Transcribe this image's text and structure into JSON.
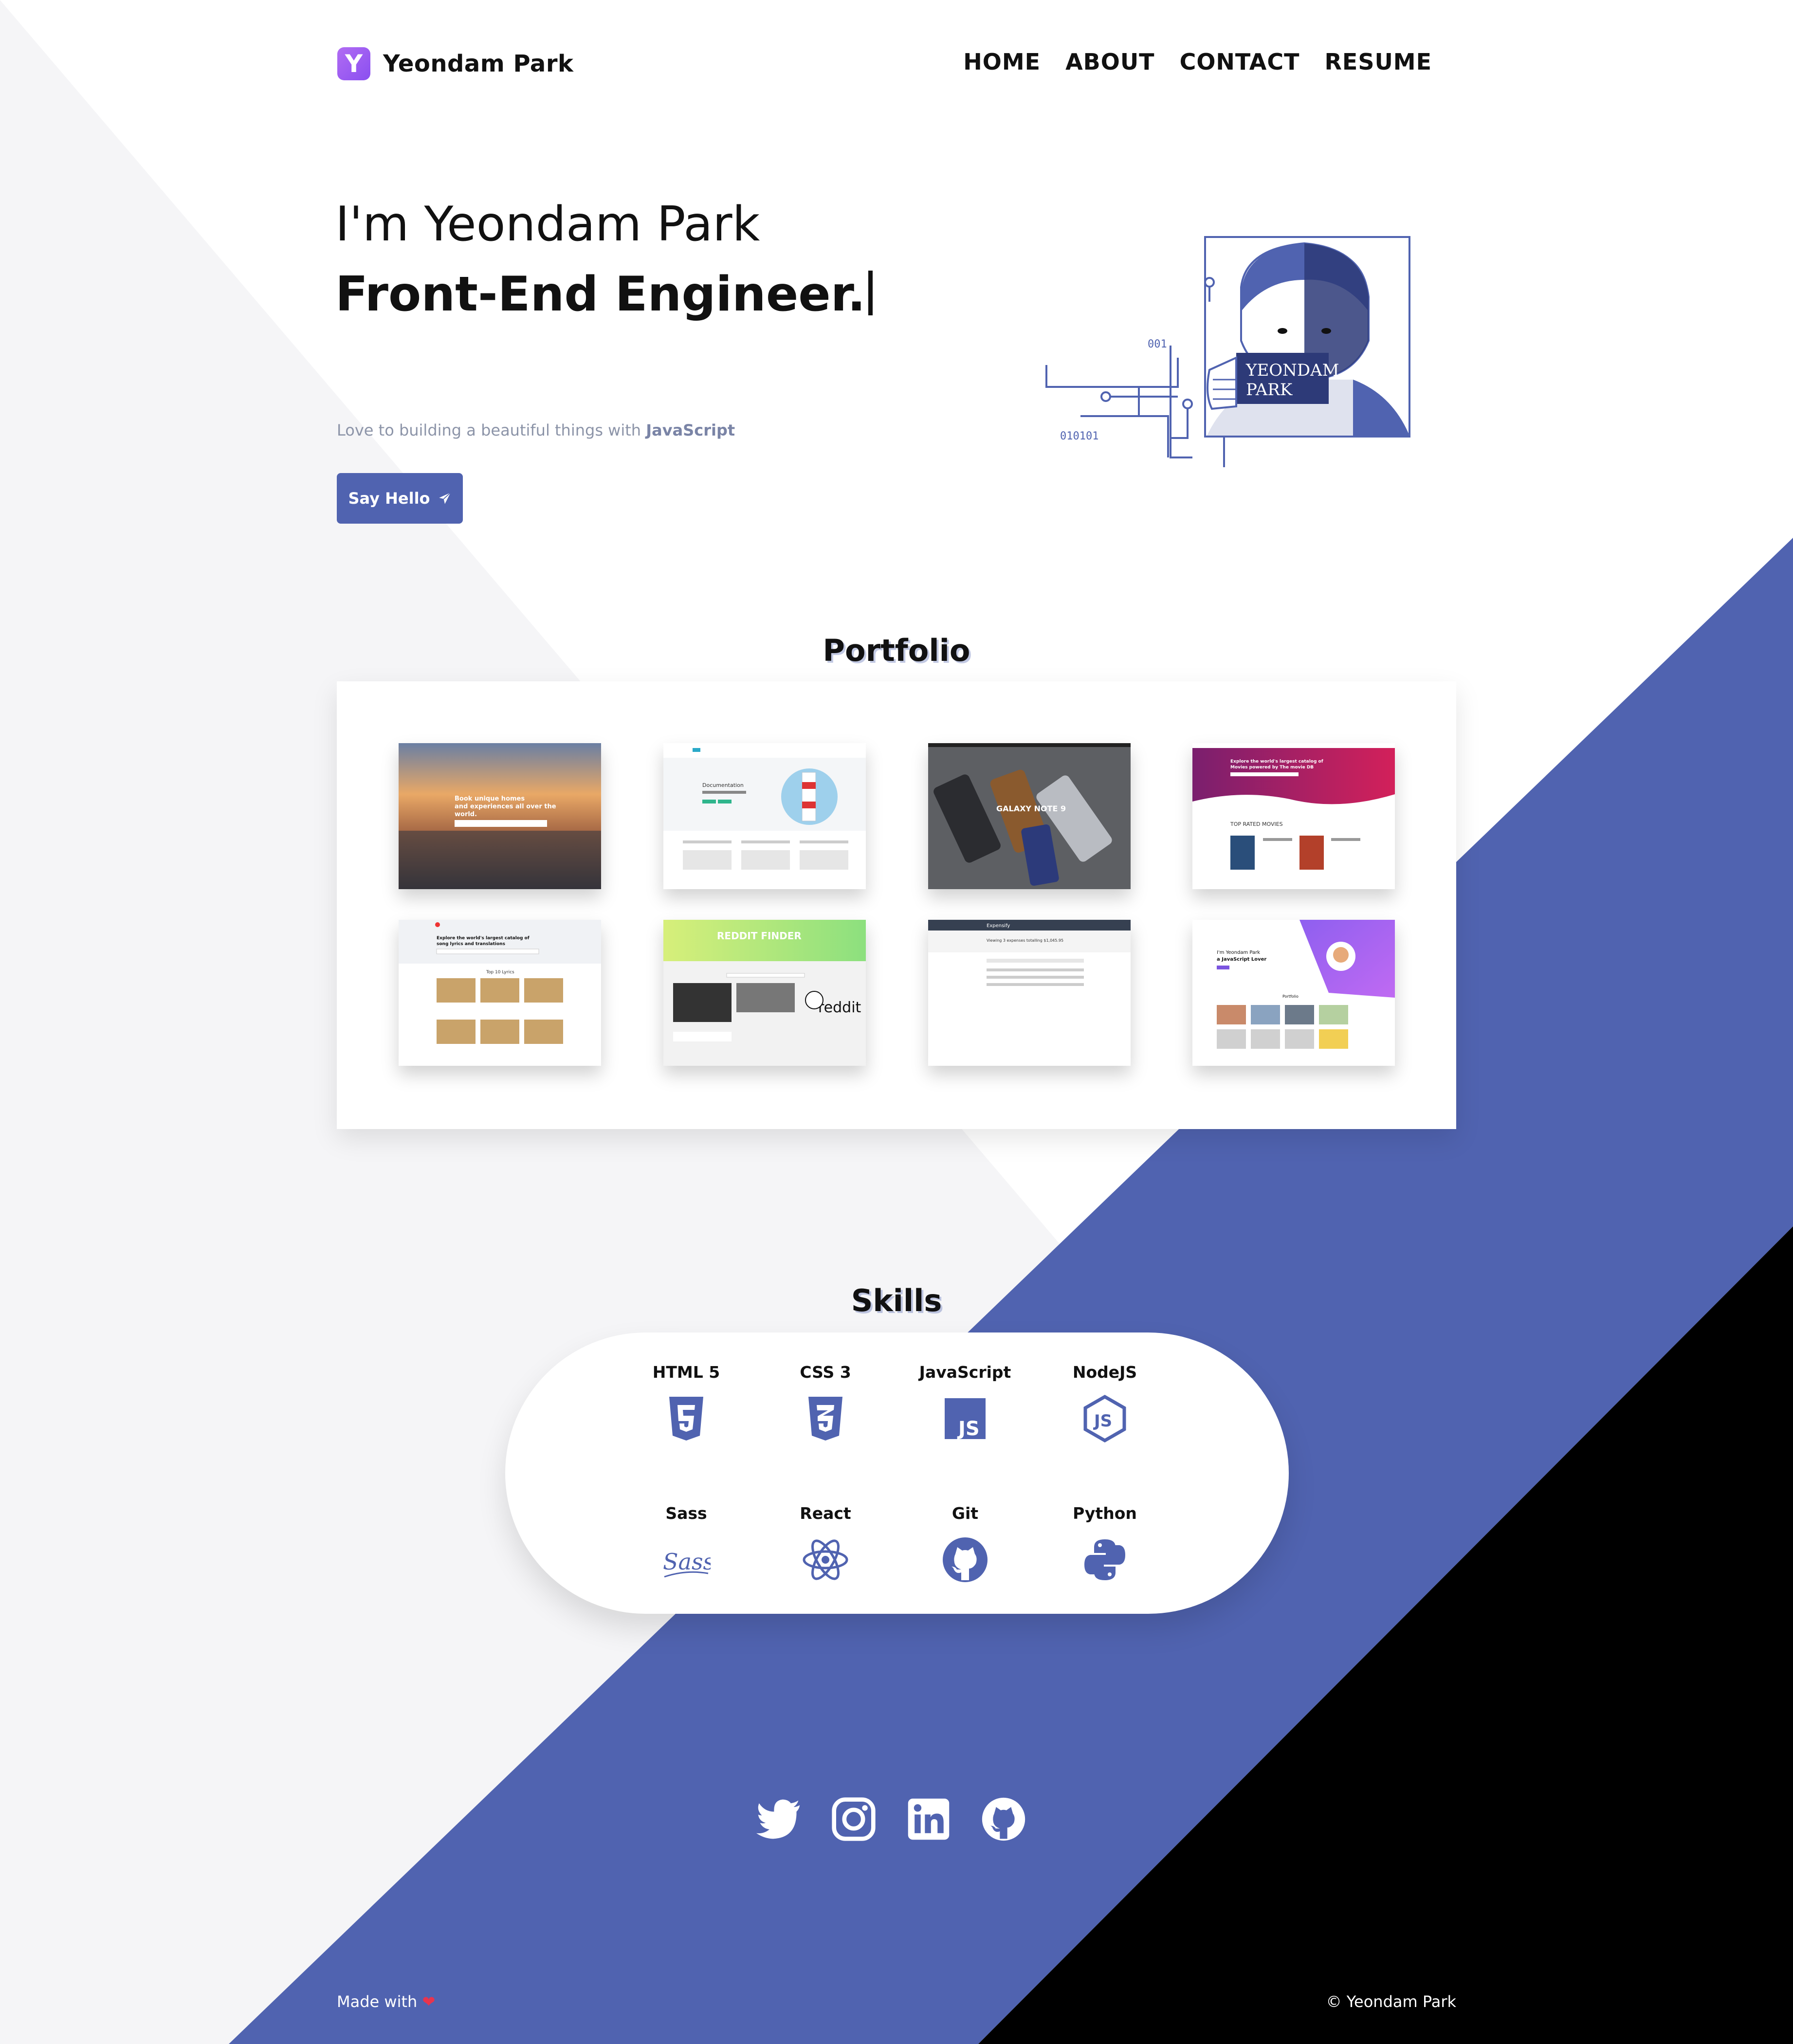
{
  "colors": {
    "accent": "#5063b0",
    "light_bg": "#f5f5f7",
    "dark": "#000000",
    "logo_purple": "#a25ef1",
    "heart": "#e8344e"
  },
  "header": {
    "logo_letter": "Y",
    "logo_name": "Yeondam Park",
    "nav": [
      "HOME",
      "ABOUT",
      "CONTACT",
      "RESUME"
    ]
  },
  "hero": {
    "greeting": "I'm Yeondam Park",
    "role": "Front-End Engineer.",
    "tagline_prefix": "Love to building a beautiful things with ",
    "tagline_highlight": "JavaScript",
    "cta_label": "Say Hello",
    "avatar_text_1": "YEONDAM",
    "avatar_text_2": "PARK",
    "avatar_code_1": "001",
    "avatar_code_2": "010101"
  },
  "portfolio": {
    "title": "Portfolio",
    "items": [
      {
        "id": "airbnb-clone",
        "text_1": "Book unique homes",
        "text_2": "and experiences all over the",
        "text_3": "world."
      },
      {
        "id": "developer-site",
        "text_1": "Documentation"
      },
      {
        "id": "galaxy-note",
        "text_1": "GALAXY NOTE 9"
      },
      {
        "id": "movie-catalog",
        "text_1": "Explore the world's largest catalog of",
        "text_2": "Movies powered by The movie DB",
        "text_3": "TOP RATED MOVIES"
      },
      {
        "id": "lyrics-finder",
        "text_1": "Explore the world's largest catalog of",
        "text_2": "song lyrics and translations",
        "text_3": "Top 10 Lyrics"
      },
      {
        "id": "reddit-finder",
        "text_1": "REDDIT FINDER",
        "text_2": "reddit"
      },
      {
        "id": "expensify",
        "text_1": "Expensify",
        "text_2": "Viewing 3 expenses totalling $1,045.95"
      },
      {
        "id": "portfolio-v1",
        "text_1": "I'm Yeondam Park",
        "text_2": "a JavaScript Lover",
        "text_3": "Portfolio"
      }
    ]
  },
  "skills": {
    "title": "Skills",
    "items": [
      {
        "label": "HTML 5",
        "icon": "html5-icon"
      },
      {
        "label": "CSS 3",
        "icon": "css3-icon"
      },
      {
        "label": "JavaScript",
        "icon": "javascript-icon"
      },
      {
        "label": "NodeJS",
        "icon": "nodejs-icon"
      },
      {
        "label": "Sass",
        "icon": "sass-icon"
      },
      {
        "label": "React",
        "icon": "react-icon"
      },
      {
        "label": "Git",
        "icon": "github-icon"
      },
      {
        "label": "Python",
        "icon": "python-icon"
      }
    ]
  },
  "social": [
    "twitter-icon",
    "instagram-icon",
    "linkedin-icon",
    "github-icon"
  ],
  "footer": {
    "made_with": "Made with",
    "copyright": "© Yeondam Park"
  }
}
